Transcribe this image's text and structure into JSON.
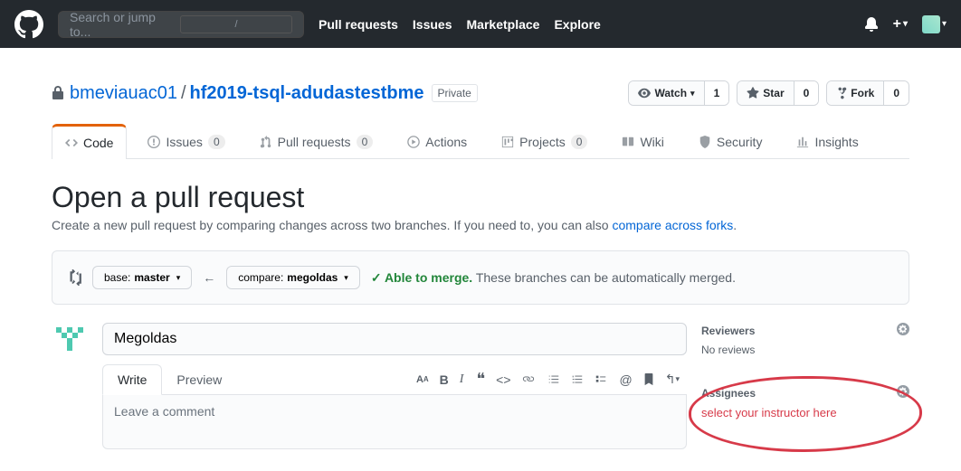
{
  "header": {
    "search_placeholder": "Search or jump to...",
    "nav": {
      "pulls": "Pull requests",
      "issues": "Issues",
      "marketplace": "Marketplace",
      "explore": "Explore"
    }
  },
  "repo": {
    "owner": "bmeviauac01",
    "name": "hf2019-tsql-adudastestbme",
    "privacy": "Private",
    "watch": {
      "label": "Watch",
      "count": "1"
    },
    "star": {
      "label": "Star",
      "count": "0"
    },
    "fork": {
      "label": "Fork",
      "count": "0"
    }
  },
  "tabs": {
    "code": "Code",
    "issues": {
      "label": "Issues",
      "count": "0"
    },
    "pulls": {
      "label": "Pull requests",
      "count": "0"
    },
    "actions": "Actions",
    "projects": {
      "label": "Projects",
      "count": "0"
    },
    "wiki": "Wiki",
    "security": "Security",
    "insights": "Insights"
  },
  "page": {
    "title": "Open a pull request",
    "subtitle_pre": "Create a new pull request by comparing changes across two branches. If you need to, you can also ",
    "subtitle_link": "compare across forks",
    "subtitle_post": "."
  },
  "compare": {
    "base_label": "base: ",
    "base_value": "master",
    "compare_label": "compare: ",
    "compare_value": "megoldas",
    "able": "Able to merge.",
    "msg": "These branches can be automatically merged."
  },
  "form": {
    "title_value": "Megoldas",
    "write_tab": "Write",
    "preview_tab": "Preview",
    "comment_placeholder": "Leave a comment"
  },
  "sidebar": {
    "reviewers": {
      "title": "Reviewers",
      "text": "No reviews"
    },
    "assignees": {
      "title": "Assignees",
      "text": "select your instructor here"
    }
  }
}
